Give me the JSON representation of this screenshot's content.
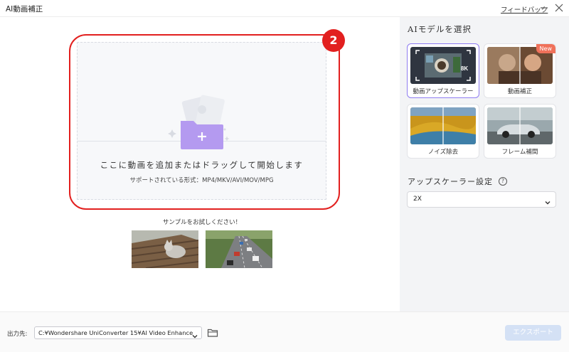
{
  "app": {
    "title": "AI動画補正",
    "feedback_label": "フィードバック"
  },
  "drop": {
    "step_number": "2",
    "main_text": "ここに動画を追加またはドラッグして開始します",
    "formats_text": "サポートされている形式：MP4/MKV/AVI/MOV/MPG"
  },
  "samples": {
    "title": "サンプルをお試しください！"
  },
  "sidebar": {
    "ai_title": "AIモデルを選択",
    "models": [
      {
        "label": "動画アップスケーラー",
        "selected": true,
        "badge": "8K"
      },
      {
        "label": "動画補正",
        "selected": false,
        "new_badge": "New"
      },
      {
        "label": "ノイズ除去",
        "selected": false
      },
      {
        "label": "フレーム補間",
        "selected": false
      }
    ],
    "upscale_title": "アップスケーラー設定",
    "help_icon": "?",
    "upscale_value": "2X"
  },
  "footer": {
    "output_label": "出力先:",
    "output_path": "C:¥Wondershare UniConverter 15¥AI Video Enhance",
    "export_label": "エクスポート"
  },
  "colors": {
    "accent": "#e2201f",
    "selected_border": "#8e7cf1",
    "folder": "#b49af0",
    "export_disabled": "#d4e1f5"
  }
}
